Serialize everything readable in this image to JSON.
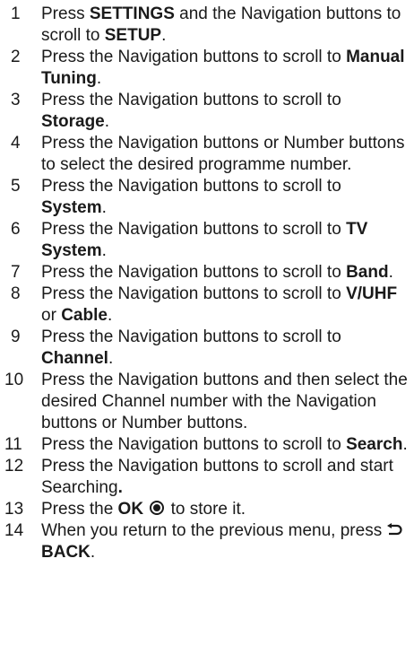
{
  "steps": [
    {
      "num": "1",
      "parts": [
        {
          "t": "Press "
        },
        {
          "t": "SETTINGS",
          "b": true
        },
        {
          "t": " and the Navigation buttons to scroll to "
        },
        {
          "t": "SETUP",
          "b": true
        },
        {
          "t": "."
        }
      ]
    },
    {
      "num": "2",
      "parts": [
        {
          "t": "Press the Navigation buttons to scroll to "
        },
        {
          "t": "Manual Tuning",
          "b": true
        },
        {
          "t": "."
        }
      ]
    },
    {
      "num": "3",
      "parts": [
        {
          "t": "Press the Navigation buttons to scroll to "
        },
        {
          "t": "Storage",
          "b": true
        },
        {
          "t": "."
        }
      ]
    },
    {
      "num": "4",
      "parts": [
        {
          "t": "Press the Navigation buttons or Number buttons to select the desired programme number."
        }
      ]
    },
    {
      "num": "5",
      "parts": [
        {
          "t": "Press the Navigation buttons to scroll to "
        },
        {
          "t": "System",
          "b": true
        },
        {
          "t": "."
        }
      ]
    },
    {
      "num": "6",
      "parts": [
        {
          "t": "Press the Navigation buttons to scroll to "
        },
        {
          "t": "TV System",
          "b": true
        },
        {
          "t": "."
        }
      ]
    },
    {
      "num": "7",
      "parts": [
        {
          "t": "Press the Navigation buttons to scroll to "
        },
        {
          "t": "Band",
          "b": true
        },
        {
          "t": "."
        }
      ]
    },
    {
      "num": "8",
      "parts": [
        {
          "t": "Press the Navigation buttons to scroll to "
        },
        {
          "t": "V/UHF",
          "b": true
        },
        {
          "t": " or "
        },
        {
          "t": "Cable",
          "b": true
        },
        {
          "t": "."
        }
      ]
    },
    {
      "num": "9",
      "parts": [
        {
          "t": "Press the Navigation buttons to scroll to "
        },
        {
          "t": "Channel",
          "b": true
        },
        {
          "t": "."
        }
      ]
    },
    {
      "num": "10",
      "parts": [
        {
          "t": "Press the Navigation buttons and then select the desired Channel number with the Navigation buttons or Number buttons."
        }
      ]
    },
    {
      "num": "11",
      "parts": [
        {
          "t": "Press the Navigation buttons to scroll to "
        },
        {
          "t": "Search",
          "b": true
        },
        {
          "t": "."
        }
      ]
    },
    {
      "num": "12",
      "parts": [
        {
          "t": "Press the Navigation buttons to scroll and start Searching"
        },
        {
          "t": ".",
          "b": true
        }
      ]
    },
    {
      "num": "13",
      "parts": [
        {
          "t": "Press the "
        },
        {
          "t": "OK",
          "b": true
        },
        {
          "t": " "
        },
        {
          "icon": "ok-button-icon"
        },
        {
          "t": " to store it."
        }
      ]
    },
    {
      "num": "14",
      "parts": [
        {
          "t": "When you return to the previous menu, press "
        },
        {
          "icon": "back-arrow-icon"
        },
        {
          "t": "BACK",
          "b": true
        },
        {
          "t": "."
        }
      ]
    }
  ]
}
